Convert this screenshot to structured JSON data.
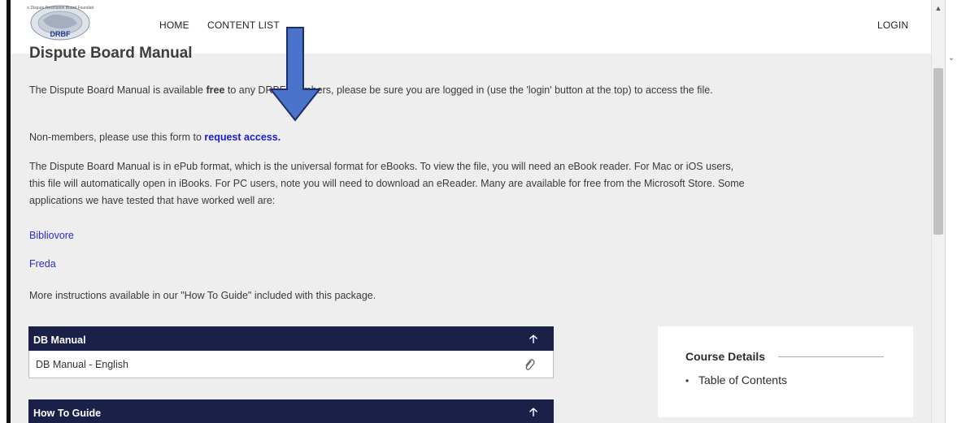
{
  "nav": {
    "home": "HOME",
    "content_list": "CONTENT LIST",
    "login": "LOGIN",
    "logo_text": "DRBF"
  },
  "page": {
    "title": "Dispute Board Manual",
    "p1_a": "The Dispute Board Manual is available ",
    "p1_b": "free",
    "p1_c": " to any DRBF Members, please be sure you are logged in (use the 'login' button at the top) to access the file.",
    "p2_a": "Non-members, please use this form to ",
    "p2_link": "request access.",
    "p3": "The Dispute Board Manual is in ePub format, which is the universal format for eBooks. To view the file, you will need an eBook reader. For Mac or iOS users, this file will automatically open in iBooks. For PC users, note you will need to download an eReader. Many are available for free from the Microsoft Store. Some applications we have tested that have worked well are:",
    "link_bibliovore": "Bibliovore",
    "link_freda": "Freda",
    "p4": "More instructions available in our \"How To Guide\" included with this package."
  },
  "accordions": {
    "db_manual": {
      "title": "DB Manual",
      "item": "DB Manual - English"
    },
    "how_to": {
      "title": "How To Guide"
    }
  },
  "course": {
    "title": "Course Details",
    "item": "Table of Contents"
  },
  "icons": {
    "arrow": "up-arrow-icon",
    "attachment": "paperclip-icon",
    "annotation": "down-arrow-annotation"
  },
  "colors": {
    "accordion_header": "#1b2049",
    "link": "#1b1bd6",
    "annotation_arrow": "#4a74c9"
  }
}
